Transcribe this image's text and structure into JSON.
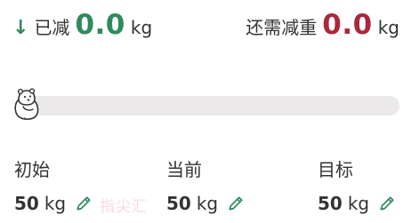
{
  "summary": {
    "lost_label": "已减",
    "lost_value": "0.0",
    "lost_unit": "kg",
    "need_label": "还需减重",
    "need_value": "0.0",
    "need_unit": "kg"
  },
  "progress": {
    "fraction": 0.0
  },
  "stats": [
    {
      "label": "初始",
      "value": "50",
      "unit": "kg"
    },
    {
      "label": "当前",
      "value": "50",
      "unit": "kg"
    },
    {
      "label": "目标",
      "value": "50",
      "unit": "kg"
    }
  ],
  "watermark": "指尖汇",
  "icons": {
    "lost": "down-arrow-icon",
    "mascot": "bear-mascot-icon",
    "edit": "pencil-icon"
  },
  "colors": {
    "lost_value": "#2f8a5b",
    "need_value": "#a9283b",
    "edit_icon": "#2f8a5b",
    "track": "#ebe9e9"
  }
}
